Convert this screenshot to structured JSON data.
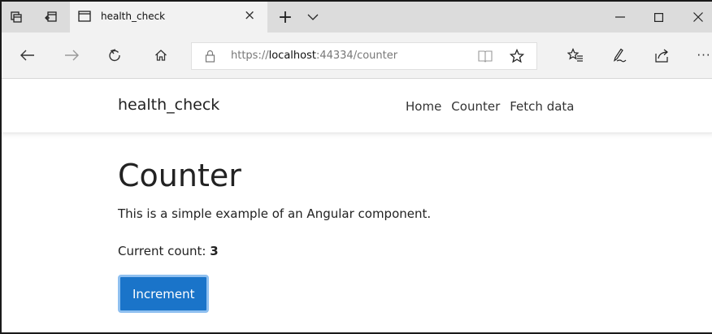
{
  "browser": {
    "tab": {
      "title": "health_check",
      "close": "×"
    },
    "new_tab": "+",
    "tab_list": "⌵",
    "window": {
      "minimize": "—",
      "maximize": "☐",
      "close": "✕"
    },
    "address": {
      "scheme": "https://",
      "host": "localhost",
      "rest": ":44334/counter"
    },
    "more": "···"
  },
  "app": {
    "brand": "health_check",
    "nav": [
      "Home",
      "Counter",
      "Fetch data"
    ]
  },
  "main": {
    "title": "Counter",
    "description": "This is a simple example of an Angular component.",
    "count_label": "Current count: ",
    "count_value": "3",
    "increment_label": "Increment"
  }
}
